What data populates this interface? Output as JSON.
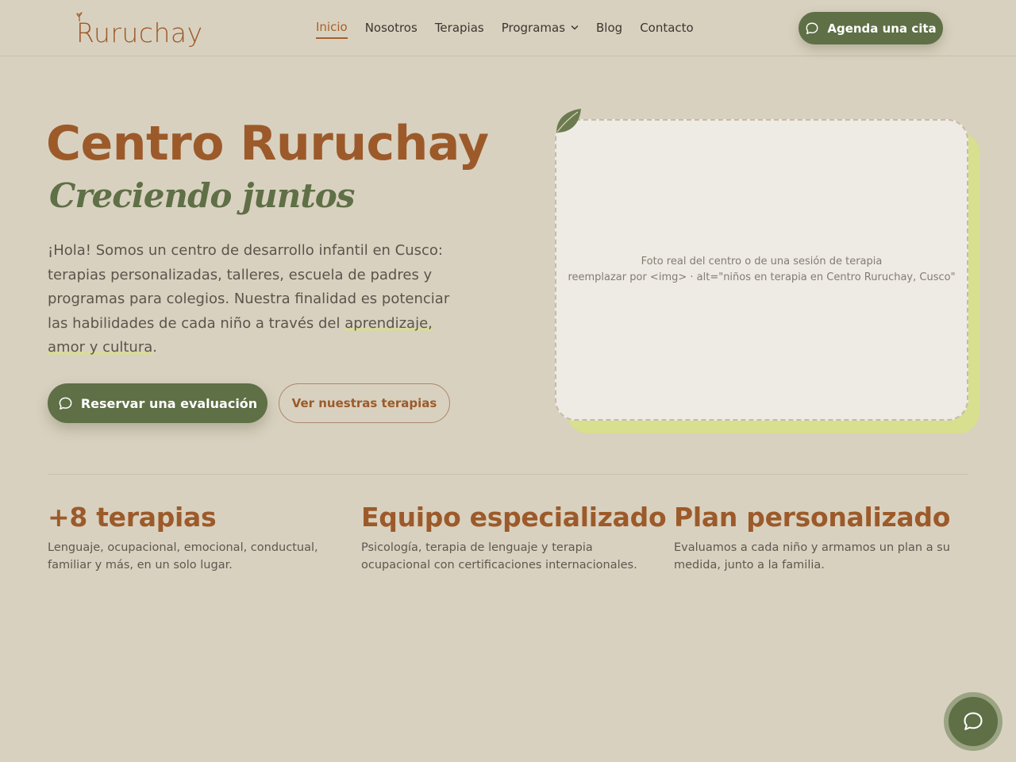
{
  "brand": {
    "logo_text": "Ruruchay"
  },
  "nav": {
    "items": [
      {
        "label": "Inicio",
        "active": true
      },
      {
        "label": "Nosotros"
      },
      {
        "label": "Terapias"
      },
      {
        "label": "Programas",
        "dropdown": true
      },
      {
        "label": "Blog"
      },
      {
        "label": "Contacto"
      }
    ],
    "cta_label": "Agenda una cita"
  },
  "hero": {
    "title": "Centro Ruruchay",
    "subtitle": "Creciendo juntos",
    "text_before": "¡Hola! Somos un centro de desarrollo infantil en Cusco: terapias personalizadas, talleres, escuela de padres y programas para colegios. Nuestra finalidad es potenciar las habilidades de cada niño a través del ",
    "text_highlight": "aprendizaje, amor y cultura",
    "text_after": ".",
    "primary_button": "Reservar una evaluación",
    "secondary_button": "Ver nuestras terapias"
  },
  "image_placeholder": {
    "line1": "Foto real del centro o de una sesión de terapia",
    "line2": "reemplazar por <img> · alt=\"niños en terapia en Centro Ruruchay, Cusco\""
  },
  "features": [
    {
      "title": "+8 terapias",
      "text": "Lenguaje, ocupacional, emocional, conductual, familiar y más, en un solo lugar."
    },
    {
      "title": "Equipo especializado",
      "text": "Psicología, terapia de lenguaje y terapia ocupacional con certificaciones internacionales."
    },
    {
      "title": "Plan personalizado",
      "text": "Evaluamos a cada niño y armamos un plan a su medida, junto a la familia."
    }
  ],
  "colors": {
    "background": "#d9d1bf",
    "brand_brown": "#9c5a2a",
    "brand_green": "#5f6f46",
    "highlight": "#d7e08e"
  },
  "icons": {
    "chat": "chat-bubble-icon",
    "chevron": "chevron-down-icon",
    "leaf": "leaf-icon",
    "sprout": "sprout-icon"
  }
}
